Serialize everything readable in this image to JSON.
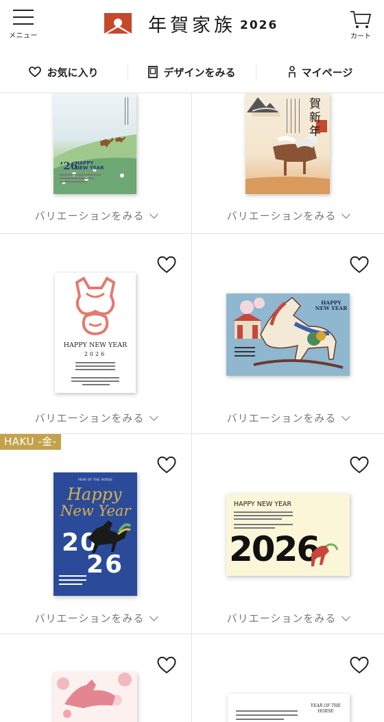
{
  "header": {
    "menu_label": "メニュー",
    "logo_text": "年賀家族",
    "logo_year": "2026",
    "cart_label": "カート",
    "brand_color": "#c6482c"
  },
  "nav": {
    "favorites": "お気に入り",
    "designs": "デザインをみる",
    "mypage": "マイページ"
  },
  "cards": [
    {
      "variation": "バリエーションをみる",
      "year_text": "’26",
      "greeting": "HAPPY NEW YEAR"
    },
    {
      "variation": "バリエーションをみる",
      "title": "賀新年"
    },
    {
      "variation": "バリエーションをみる",
      "greeting": "HAPPY NEW YEAR",
      "year": "2026"
    },
    {
      "variation": "バリエーションをみる",
      "greeting": "HAPPY NEW YEAR"
    },
    {
      "variation": "バリエーションをみる",
      "badge": "HAKU -金-",
      "script1": "Happy",
      "script2": "New Year",
      "year_top": "20",
      "year_bottom": "26",
      "small_top": "YEAR OF THE HORSE"
    },
    {
      "variation": "バリエーションをみる",
      "greeting": "HAPPY NEW YEAR",
      "year": "2026"
    },
    {
      "variation": "",
      "title": ""
    },
    {
      "variation": "",
      "small": "YEAR OF THE HORSE"
    }
  ]
}
